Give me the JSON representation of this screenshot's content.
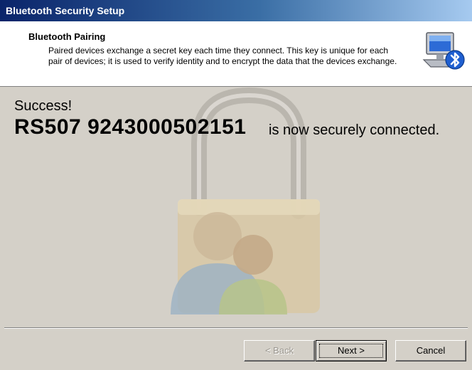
{
  "window": {
    "title": "Bluetooth Security Setup"
  },
  "header": {
    "title": "Bluetooth Pairing",
    "description": "Paired devices exchange a secret key each time they connect. This key is unique for each pair of devices; it is used to verify identity and to encrypt the data that the devices exchange.",
    "icon": "bluetooth-computer-icon"
  },
  "main": {
    "success": "Success!",
    "device_name": "RS507 9243000502151",
    "connected_message": "is now securely connected.",
    "background_art": "padlock-users-watermark"
  },
  "buttons": {
    "back": {
      "label": "< Back",
      "enabled": false
    },
    "next": {
      "label": "Next >",
      "enabled": true,
      "focused": true
    },
    "cancel": {
      "label": "Cancel",
      "enabled": true
    }
  },
  "colors": {
    "title_gradient_start": "#0a246a",
    "title_gradient_end": "#a6caf0",
    "dialog_bg": "#d4d0c8",
    "header_bg": "#ffffff",
    "bluetooth_blue": "#1f5fd0"
  }
}
